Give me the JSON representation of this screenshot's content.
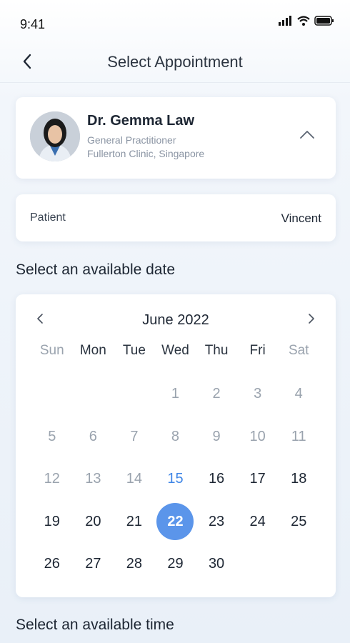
{
  "status_bar": {
    "time": "9:41",
    "icons": [
      "signal-icon",
      "wifi-icon",
      "battery-icon"
    ]
  },
  "nav": {
    "title": "Select Appointment",
    "back_icon": "chevron-left-icon"
  },
  "doctor": {
    "name": "Dr. Gemma Law",
    "role": "General Practitioner",
    "clinic": "Fullerton Clinic, Singapore",
    "expand_icon": "chevron-up-icon"
  },
  "patient": {
    "label": "Patient",
    "value": "Vincent"
  },
  "date_section": {
    "title": "Select an available date"
  },
  "calendar": {
    "month_label": "June 2022",
    "weekdays": [
      "Sun",
      "Mon",
      "Tue",
      "Wed",
      "Thu",
      "Fri",
      "Sat"
    ],
    "first_weekday_index": 3,
    "days_in_month": 30,
    "past_until": 14,
    "today": 15,
    "selected": 22
  },
  "time_section": {
    "title": "Select an available time"
  },
  "colors": {
    "accent": "#5b95ea",
    "today": "#3f86e6",
    "muted": "#9aa3ae",
    "text": "#1d2633"
  }
}
